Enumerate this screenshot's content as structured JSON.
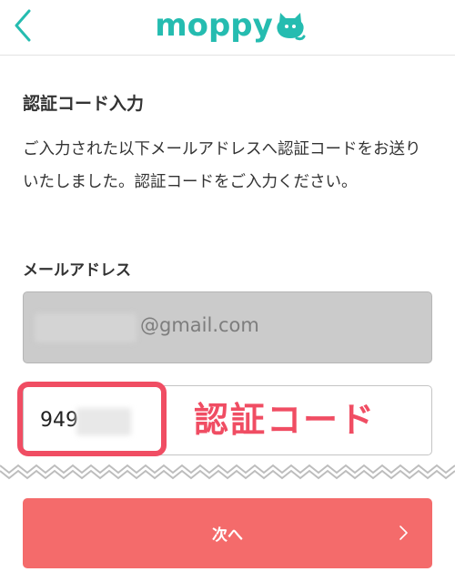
{
  "header": {
    "logo_text": "moppy",
    "back_icon": "chevron-left-icon",
    "logo_mascot_icon": "cat-mascot-icon"
  },
  "main": {
    "title": "認証コード入力",
    "description": "ご入力された以下メールアドレスへ認証コードをお送りいたしました。認証コードをご入力ください。",
    "email_label": "メールアドレス",
    "email_value": "@gmail.com",
    "code_value": "949"
  },
  "annotation": {
    "label": "認証コード"
  },
  "footer": {
    "next_label": "次へ",
    "chevron_icon": "chevron-right-icon"
  },
  "colors": {
    "brand": "#25bcb0",
    "accent": "#f04d63",
    "button": "#f46b6b"
  }
}
